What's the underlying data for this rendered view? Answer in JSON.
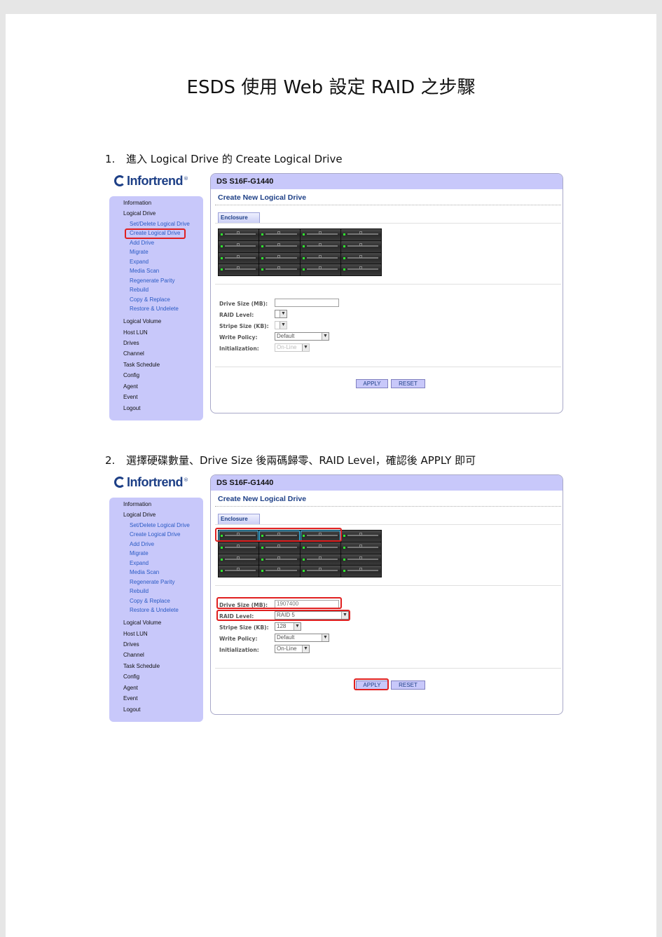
{
  "doc": {
    "title": "ESDS 使用 Web 設定 RAID 之步驟"
  },
  "steps": [
    {
      "num": "1.",
      "text": "進入 Logical Drive 的 Create Logical Drive"
    },
    {
      "num": "2.",
      "text": "選擇硬碟數量、Drive Size 後兩碼歸零、RAID Level，確認後 APPLY 即可"
    }
  ],
  "logo": {
    "text": "Infortrend",
    "tm": "®"
  },
  "nav": {
    "items": [
      {
        "label": "Information",
        "level": "main"
      },
      {
        "label": "Logical Drive",
        "level": "main"
      },
      {
        "label": "Set/Delete Logical Drive",
        "level": "sub"
      },
      {
        "label": "Create Logical Drive",
        "level": "sub"
      },
      {
        "label": "Add Drive",
        "level": "sub"
      },
      {
        "label": "Migrate",
        "level": "sub"
      },
      {
        "label": "Expand",
        "level": "sub"
      },
      {
        "label": "Media Scan",
        "level": "sub"
      },
      {
        "label": "Regenerate Parity",
        "level": "sub"
      },
      {
        "label": "Rebuild",
        "level": "sub"
      },
      {
        "label": "Copy & Replace",
        "level": "sub"
      },
      {
        "label": "Restore & Undelete",
        "level": "sub"
      },
      {
        "label": "Logical Volume",
        "level": "main"
      },
      {
        "label": "Host LUN",
        "level": "main"
      },
      {
        "label": "Drives",
        "level": "main"
      },
      {
        "label": "Channel",
        "level": "main"
      },
      {
        "label": "Task Schedule",
        "level": "main"
      },
      {
        "label": "Config",
        "level": "main"
      },
      {
        "label": "Agent",
        "level": "main"
      },
      {
        "label": "Event",
        "level": "main"
      },
      {
        "label": "Logout",
        "level": "main"
      }
    ]
  },
  "panel": {
    "header": "DS S16F-G1440",
    "title": "Create New Logical Drive",
    "tab": "Enclosure",
    "labels": {
      "drive_size": "Drive Size (MB):",
      "raid_level": "RAID Level:",
      "stripe_size": "Stripe Size (KB):",
      "write_policy": "Write Policy:",
      "initialization": "Initialization:"
    },
    "apply": "APPLY",
    "reset": "RESET"
  },
  "shot1": {
    "drive_size": "",
    "raid_level": "",
    "stripe_size": "",
    "write_policy": "Default",
    "initialization": "On-Line",
    "selected_slots": []
  },
  "shot2": {
    "drive_size": "1907400",
    "raid_level": "RAID 5",
    "stripe_size": "128",
    "write_policy": "Default",
    "initialization": "On-Line",
    "selected_slots": [
      0,
      1,
      2
    ]
  },
  "colors": {
    "accent": "#1d3f86",
    "panel": "#c8c8fa",
    "highlight": "#e02020",
    "led": "#2ee82e"
  }
}
